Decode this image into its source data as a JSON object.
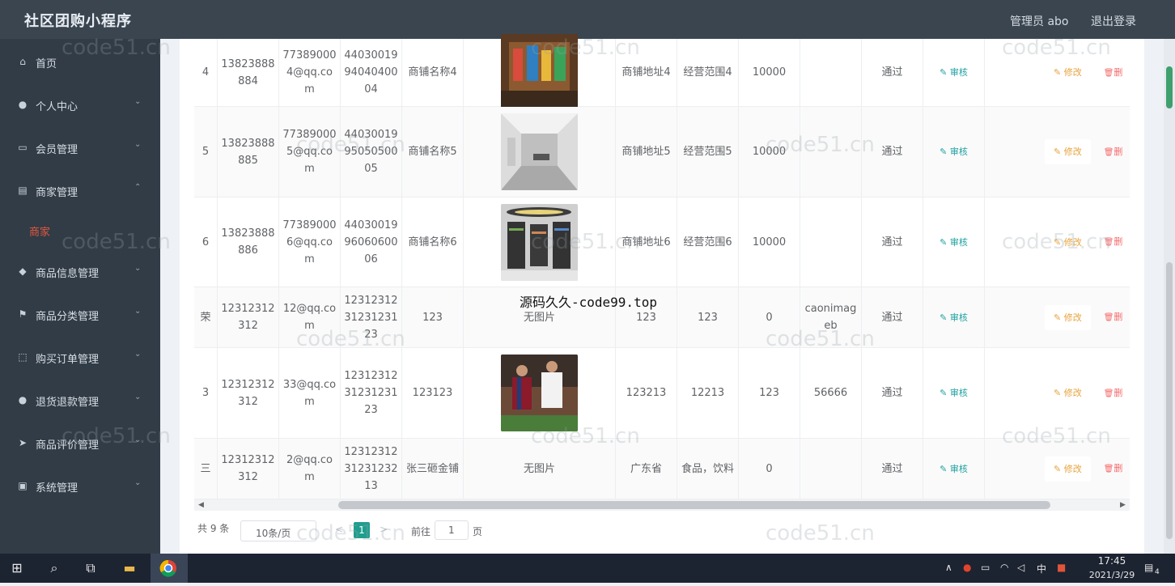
{
  "app": {
    "title": "社区团购小程序",
    "admin": "管理员 abo",
    "logout": "退出登录"
  },
  "sidebar": {
    "items": [
      {
        "label": "首页",
        "icon": "home-icon",
        "glyph": "⌂",
        "chevron": ""
      },
      {
        "label": "个人中心",
        "icon": "user-icon",
        "glyph": "●",
        "chevron": "⌄"
      },
      {
        "label": "会员管理",
        "icon": "chat-icon",
        "glyph": "▭",
        "chevron": "⌄"
      },
      {
        "label": "商家管理",
        "icon": "shop-icon",
        "glyph": "▤",
        "chevron": "⌃"
      },
      {
        "label": "商品信息管理",
        "icon": "shield-icon",
        "glyph": "◆",
        "chevron": "⌄"
      },
      {
        "label": "商品分类管理",
        "icon": "flag-icon",
        "glyph": "⚑",
        "chevron": "⌄"
      },
      {
        "label": "购买订单管理",
        "icon": "frame-icon",
        "glyph": "⬚",
        "chevron": "⌄"
      },
      {
        "label": "退货退款管理",
        "icon": "user-icon",
        "glyph": "●",
        "chevron": "⌄"
      },
      {
        "label": "商品评价管理",
        "icon": "send-icon",
        "glyph": "➤",
        "chevron": "⌄"
      },
      {
        "label": "系统管理",
        "icon": "cabinet-icon",
        "glyph": "▣",
        "chevron": "⌄"
      }
    ],
    "sub_active": "商家"
  },
  "table": {
    "rows": [
      {
        "id": "4",
        "phone": "13823888884",
        "email": "773890004@qq.com",
        "idcard": "440300199404040004",
        "shop": "商铺名称4",
        "image": "photo-toystore",
        "addr": "商铺地址4",
        "scope": "经营范围4",
        "amount": "10000",
        "reply": "",
        "status": "通过",
        "review": "审核",
        "edit": "修改",
        "del": "删"
      },
      {
        "id": "5",
        "phone": "13823888885",
        "email": "773890005@qq.com",
        "idcard": "440300199505050005",
        "shop": "商铺名称5",
        "image": "photo-office",
        "addr": "商铺地址5",
        "scope": "经营范围5",
        "amount": "10000",
        "reply": "",
        "status": "通过",
        "review": "审核",
        "edit": "修改",
        "del": "删"
      },
      {
        "id": "6",
        "phone": "13823888886",
        "email": "773890006@qq.com",
        "idcard": "440300199606060006",
        "shop": "商铺名称6",
        "image": "photo-supermarket",
        "addr": "商铺地址6",
        "scope": "经营范围6",
        "amount": "10000",
        "reply": "",
        "status": "通过",
        "review": "审核",
        "edit": "修改",
        "del": "删"
      },
      {
        "id": "荣",
        "phone": "12312312312",
        "email": "12@qq.com",
        "idcard": "123123123123123123",
        "shop": "123",
        "image": "",
        "noimg": "无图片",
        "addr": "123",
        "scope": "123",
        "amount": "0",
        "reply": "caonimageb",
        "status": "通过",
        "review": "审核",
        "edit": "修改",
        "del": "删"
      },
      {
        "id": "3",
        "phone": "12312312312",
        "email": "33@qq.com",
        "idcard": "123123123123123123",
        "shop": "123123",
        "image": "photo-football",
        "addr": "123213",
        "scope": "12213",
        "amount": "123",
        "reply": "56666",
        "status": "通过",
        "review": "审核",
        "edit": "修改",
        "del": "删"
      },
      {
        "id": "三",
        "phone": "12312312312",
        "email": "2@qq.com",
        "idcard": "123123123123123213",
        "shop": "张三砸金铺",
        "image": "",
        "noimg": "无图片",
        "addr": "广东省",
        "scope": "食品，饮料",
        "amount": "0",
        "reply": "",
        "status": "通过",
        "review": "审核",
        "edit": "修改",
        "del": "删"
      }
    ]
  },
  "pagination": {
    "total": "共 9 条",
    "page_size": "10条/页",
    "current": "1",
    "goto_label": "前往",
    "goto_value": "1",
    "page_suffix": "页",
    "prev": "<",
    "next": ">"
  },
  "overlay": "源码久久-code99.top",
  "watermark": "code51.cn",
  "taskbar": {
    "time": "17:45",
    "date": "2021/3/29",
    "ime": "中",
    "notifications": "4"
  },
  "colors": {
    "topbar": "#3a4550",
    "sidebar": "#313c47",
    "accent": "#1e9e8e",
    "active_sub": "#e4573d"
  }
}
